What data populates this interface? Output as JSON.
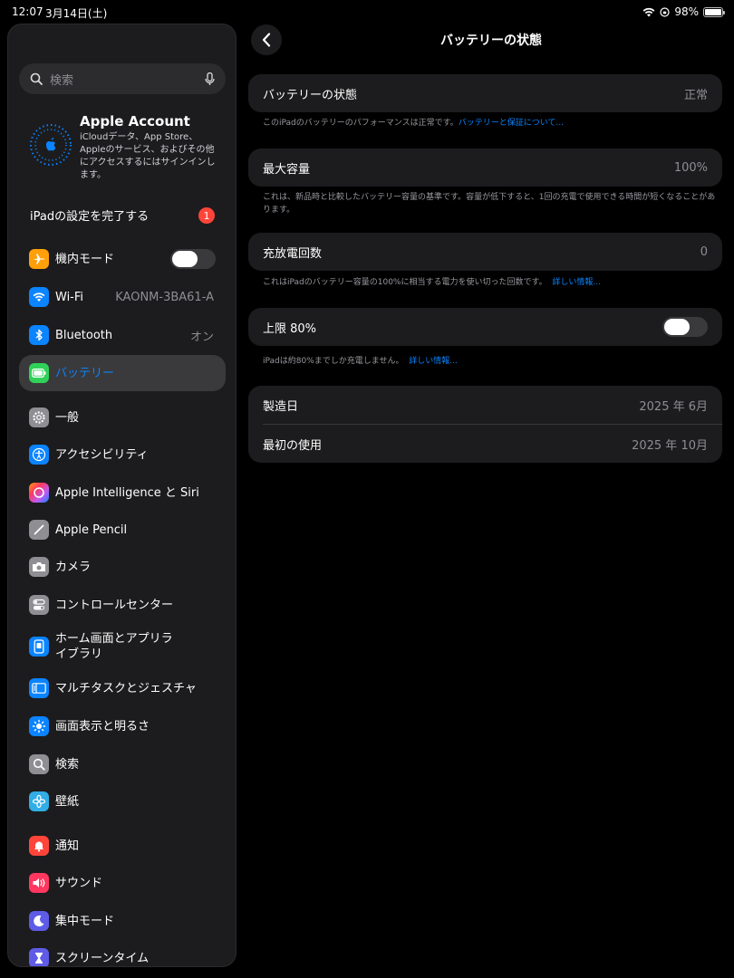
{
  "status_bar": {
    "time": "12:07",
    "date": "3月14日(土)",
    "battery": "98%"
  },
  "sidebar": {
    "search_placeholder": "検索",
    "account": {
      "title": "Apple Account",
      "description": "iCloudデータ、App Store、Appleのサービス、およびその他にアクセスするにはサインインします。"
    },
    "setup": {
      "label": "iPadの設定を完了する",
      "badge": "1"
    },
    "items": [
      {
        "label": "機内モード",
        "icon": "airplane-icon",
        "color": "#ff9f0a",
        "toggle": false
      },
      {
        "label": "Wi-Fi",
        "icon": "wifi-icon",
        "color": "#0a84ff",
        "value": "KAONM-3BA61-A"
      },
      {
        "label": "Bluetooth",
        "icon": "bluetooth-icon",
        "color": "#0a84ff",
        "value": "オン"
      },
      {
        "label": "バッテリー",
        "icon": "battery-icon",
        "color": "#30d158",
        "selected": true
      },
      {
        "label": "一般",
        "icon": "gear-icon",
        "color": "#8e8e93"
      },
      {
        "label": "アクセシビリティ",
        "icon": "accessibility-icon",
        "color": "#0a84ff"
      },
      {
        "label": "Apple Intelligence と Siri",
        "icon": "siri-icon",
        "color": "#bf5af2"
      },
      {
        "label": "Apple Pencil",
        "icon": "pencil-icon",
        "color": "#8e8e93"
      },
      {
        "label": "カメラ",
        "icon": "camera-icon",
        "color": "#8e8e93"
      },
      {
        "label": "コントロールセンター",
        "icon": "control-center-icon",
        "color": "#8e8e93"
      },
      {
        "label": "ホーム画面とアプリライブラリ",
        "icon": "home-screen-icon",
        "color": "#0a84ff"
      },
      {
        "label": "マルチタスクとジェスチャ",
        "icon": "multitask-icon",
        "color": "#0a84ff"
      },
      {
        "label": "画面表示と明るさ",
        "icon": "brightness-icon",
        "color": "#0a84ff"
      },
      {
        "label": "検索",
        "icon": "search-icon",
        "color": "#8e8e93"
      },
      {
        "label": "壁紙",
        "icon": "wallpaper-icon",
        "color": "#32ade6"
      },
      {
        "label": "通知",
        "icon": "notification-icon",
        "color": "#ff453a"
      },
      {
        "label": "サウンド",
        "icon": "sound-icon",
        "color": "#ff375f"
      },
      {
        "label": "集中モード",
        "icon": "focus-icon",
        "color": "#5e5ce6"
      },
      {
        "label": "スクリーンタイム",
        "icon": "screentime-icon",
        "color": "#5e5ce6"
      }
    ]
  },
  "main": {
    "title": "バッテリーの状態",
    "health": {
      "label": "バッテリーの状態",
      "value": "正常"
    },
    "health_note": "このiPadのバッテリーのパフォーマンスは正常です。",
    "health_link": "バッテリーと保証について...",
    "capacity": {
      "label": "最大容量",
      "value": "100%"
    },
    "capacity_note": "これは、新品時と比較したバッテリー容量の基準です。容量が低下すると、1回の充電で使用できる時間が短くなることがあります。",
    "cycles": {
      "label": "充放電回数",
      "value": "0"
    },
    "cycles_note": "これはiPadのバッテリー容量の100%に相当する電力を使い切った回数です。",
    "cycles_link": "詳しい情報...",
    "limit": {
      "label": "上限 80%",
      "toggle": false
    },
    "limit_note": "iPadは約80%までしか充電しません。",
    "limit_link": "詳しい情報...",
    "manufactured": {
      "label": "製造日",
      "value": "2025 年 6月"
    },
    "first_use": {
      "label": "最初の使用",
      "value": "2025 年 10月"
    }
  }
}
